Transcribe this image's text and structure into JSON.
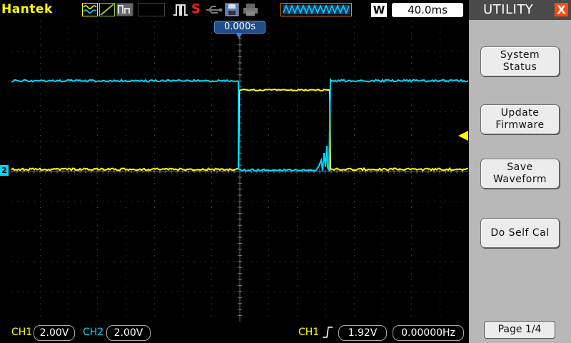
{
  "brand": "Hantek",
  "top": {
    "run_state": "S",
    "timebase_mode": "W",
    "timebase": "40.0ms"
  },
  "screen": {
    "trigger_position": "0.000s",
    "ch2_marker": "2"
  },
  "menu": {
    "title": "UTILITY",
    "close_label": "X",
    "buttons": [
      {
        "line1": "System",
        "line2": "Status"
      },
      {
        "line1": "Update",
        "line2": "Firmware"
      },
      {
        "line1": "Save",
        "line2": "Waveform"
      },
      {
        "line1": "Do Self Cal",
        "line2": ""
      }
    ],
    "page": "Page 1/4"
  },
  "bottom": {
    "ch1_label": "CH1",
    "ch1_scale": "2.00V",
    "ch2_label": "CH2",
    "ch2_scale": "2.00V",
    "trig_source": "CH1",
    "trig_level": "1.92V",
    "frequency": "0.00000Hz"
  },
  "colors": {
    "ch1": "#ffff00",
    "ch2": "#00d8ff",
    "trigger_marker": "#ffff00",
    "menu_bg": "#b8b8b8",
    "run_state": "#ff2020"
  }
}
